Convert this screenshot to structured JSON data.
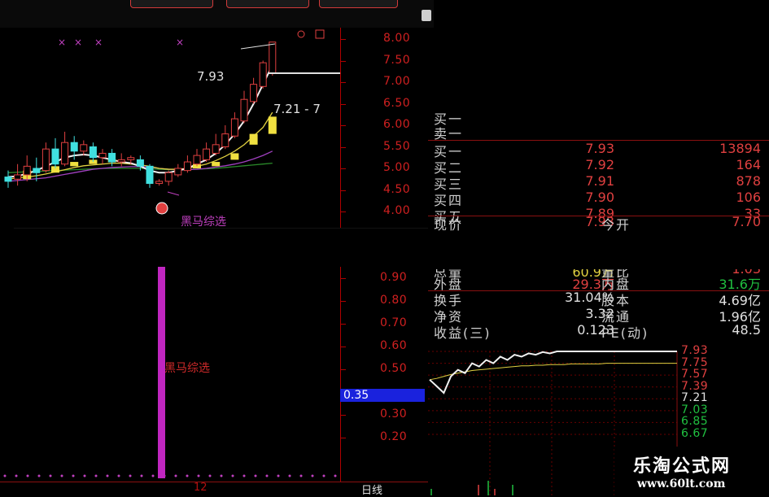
{
  "kline": {
    "price_ticks": [
      "8.00",
      "7.50",
      "7.00",
      "6.50",
      "6.00",
      "5.50",
      "5.00",
      "4.50",
      "4.00"
    ],
    "high_price": "7.93",
    "ref_price": "7.21 - 7",
    "signal_label": "黑马综选",
    "candles": [
      {
        "o": 4.8,
        "c": 4.7,
        "h": 4.95,
        "l": 4.55
      },
      {
        "o": 4.75,
        "c": 4.85,
        "h": 5.1,
        "l": 4.6
      },
      {
        "o": 4.85,
        "c": 5.05,
        "h": 5.3,
        "l": 4.7
      },
      {
        "o": 5.0,
        "c": 4.9,
        "h": 5.25,
        "l": 4.7
      },
      {
        "o": 4.95,
        "c": 5.45,
        "h": 5.6,
        "l": 4.9
      },
      {
        "o": 5.45,
        "c": 5.1,
        "h": 5.7,
        "l": 5.0
      },
      {
        "o": 5.1,
        "c": 5.6,
        "h": 5.85,
        "l": 5.05
      },
      {
        "o": 5.6,
        "c": 5.4,
        "h": 5.75,
        "l": 5.2
      },
      {
        "o": 5.4,
        "c": 5.55,
        "h": 5.65,
        "l": 5.3
      },
      {
        "o": 5.5,
        "c": 5.25,
        "h": 5.6,
        "l": 5.15
      },
      {
        "o": 5.25,
        "c": 5.35,
        "h": 5.45,
        "l": 5.1
      },
      {
        "o": 5.35,
        "c": 5.15,
        "h": 5.45,
        "l": 5.05
      },
      {
        "o": 5.15,
        "c": 5.2,
        "h": 5.35,
        "l": 5.05
      },
      {
        "o": 5.2,
        "c": 5.25,
        "h": 5.3,
        "l": 5.1
      },
      {
        "o": 5.2,
        "c": 5.05,
        "h": 5.3,
        "l": 4.95
      },
      {
        "o": 5.05,
        "c": 4.65,
        "h": 5.1,
        "l": 4.55
      },
      {
        "o": 4.65,
        "c": 4.7,
        "h": 4.75,
        "l": 4.6
      },
      {
        "o": 4.7,
        "c": 4.9,
        "h": 4.95,
        "l": 4.6
      },
      {
        "o": 4.85,
        "c": 5.0,
        "h": 5.1,
        "l": 4.8
      },
      {
        "o": 4.95,
        "c": 5.15,
        "h": 5.3,
        "l": 4.9
      },
      {
        "o": 5.1,
        "c": 5.3,
        "h": 5.45,
        "l": 5.05
      },
      {
        "o": 5.2,
        "c": 5.45,
        "h": 5.6,
        "l": 5.15
      },
      {
        "o": 5.35,
        "c": 5.55,
        "h": 5.8,
        "l": 5.3
      },
      {
        "o": 5.5,
        "c": 5.8,
        "h": 6.0,
        "l": 5.45
      },
      {
        "o": 5.75,
        "c": 6.15,
        "h": 6.3,
        "l": 5.7
      },
      {
        "o": 6.1,
        "c": 6.6,
        "h": 6.8,
        "l": 6.05
      },
      {
        "o": 6.55,
        "c": 6.95,
        "h": 7.1,
        "l": 6.5
      },
      {
        "o": 6.9,
        "c": 7.45,
        "h": 7.5,
        "l": 6.85
      },
      {
        "o": 7.2,
        "c": 7.93,
        "h": 7.93,
        "l": 7.15
      }
    ],
    "ma_white": [
      4.8,
      4.82,
      4.88,
      4.95,
      5.05,
      5.15,
      5.25,
      5.3,
      5.32,
      5.3,
      5.25,
      5.2,
      5.15,
      5.12,
      5.05,
      4.95,
      4.9,
      4.9,
      4.95,
      5.0,
      5.1,
      5.2,
      5.35,
      5.55,
      5.8,
      6.1,
      6.5,
      6.95,
      7.4
    ],
    "ma_yellow": [
      4.75,
      4.78,
      4.8,
      4.83,
      4.87,
      4.92,
      4.97,
      5.02,
      5.06,
      5.08,
      5.1,
      5.12,
      5.12,
      5.1,
      5.08,
      5.05,
      5.0,
      4.98,
      4.98,
      5.0,
      5.05,
      5.1,
      5.18,
      5.28,
      5.4,
      5.55,
      5.75,
      5.95,
      6.3
    ],
    "ma_purple": [
      4.7,
      4.72,
      4.74,
      4.76,
      4.78,
      4.82,
      4.86,
      4.9,
      4.94,
      4.98,
      5.0,
      5.02,
      5.03,
      5.04,
      5.04,
      5.03,
      5.0,
      4.98,
      4.97,
      4.97,
      4.98,
      5.0,
      5.03,
      5.06,
      5.1,
      5.15,
      5.22,
      5.3,
      5.4
    ],
    "ma_green": [
      4.9,
      4.91,
      4.92,
      4.93,
      4.94,
      4.95,
      4.96,
      4.97,
      4.98,
      4.99,
      5.0,
      5.0,
      5.0,
      5.0,
      5.0,
      4.99,
      4.98,
      4.97,
      4.97,
      4.97,
      4.98,
      4.99,
      5.0,
      5.02,
      5.04,
      5.06,
      5.08,
      5.1,
      5.12
    ],
    "yellow_blocks": [
      {
        "i": 2,
        "lo": 4.75,
        "hi": 4.95
      },
      {
        "i": 5,
        "lo": 4.9,
        "hi": 5.05
      },
      {
        "i": 7,
        "lo": 5.05,
        "hi": 5.15
      },
      {
        "i": 9,
        "lo": 5.1,
        "hi": 5.2
      },
      {
        "i": 11,
        "lo": 5.15,
        "hi": 5.2
      },
      {
        "i": 20,
        "lo": 5.0,
        "hi": 5.1
      },
      {
        "i": 22,
        "lo": 5.05,
        "hi": 5.15
      },
      {
        "i": 24,
        "lo": 5.2,
        "hi": 5.35
      },
      {
        "i": 26,
        "lo": 5.55,
        "hi": 5.8
      },
      {
        "i": 28,
        "lo": 5.8,
        "hi": 6.2
      }
    ]
  },
  "indicator": {
    "ticks": [
      "0.90",
      "0.80",
      "0.70",
      "0.60",
      "0.50",
      "0.30",
      "0.20"
    ],
    "current_value": "0.35",
    "label": "黑马综选"
  },
  "bottom": {
    "date_label": "12",
    "cycle_label": "日线"
  },
  "quote": {
    "header_rows": [
      {
        "label": "买一"
      },
      {
        "label": "卖一"
      }
    ],
    "bid_rows": [
      {
        "label": "买一",
        "price": "7.93",
        "volume": "13894"
      },
      {
        "label": "买二",
        "price": "7.92",
        "volume": "164"
      },
      {
        "label": "买三",
        "price": "7.91",
        "volume": "878"
      },
      {
        "label": "买四",
        "price": "7.90",
        "volume": "106"
      },
      {
        "label": "买五",
        "price": "7.89",
        "volume": "33"
      }
    ],
    "current": {
      "label": "现价",
      "value": "7.93",
      "label2": "今开",
      "value2": "7.70"
    },
    "partial": {
      "label": "总量",
      "value": "60.9万",
      "label2": "量比",
      "value2": "1.03"
    },
    "outer": {
      "label": "外盘",
      "value": "29.3万",
      "label2": "内盘",
      "value2": "31.6万"
    },
    "stats": [
      {
        "label": "换手",
        "value": "31.04%",
        "label2": "股本",
        "value2": "4.69亿"
      },
      {
        "label": "净资",
        "value": "3.32",
        "label2": "流通",
        "value2": "1.96亿"
      },
      {
        "label": "收益(三)",
        "value": "0.123",
        "label2": "PE(动)",
        "value2": "48.5"
      }
    ],
    "colors": {
      "red": "#e04040",
      "green": "#20c040",
      "white": "#e0e0e0"
    }
  },
  "intraday": {
    "ticks": [
      {
        "v": "7.93",
        "color": "#e04040"
      },
      {
        "v": "7.75",
        "color": "#e04040"
      },
      {
        "v": "7.57",
        "color": "#e04040"
      },
      {
        "v": "7.39",
        "color": "#e04040"
      },
      {
        "v": "7.21",
        "color": "#e0e0e0"
      },
      {
        "v": "7.03",
        "color": "#20c040"
      },
      {
        "v": "6.85",
        "color": "#20c040"
      },
      {
        "v": "6.67",
        "color": "#20c040"
      }
    ],
    "price_line": [
      7.5,
      7.4,
      7.3,
      7.55,
      7.65,
      7.6,
      7.75,
      7.7,
      7.8,
      7.75,
      7.85,
      7.8,
      7.88,
      7.85,
      7.9,
      7.88,
      7.92,
      7.9,
      7.93,
      7.93,
      7.93,
      7.93,
      7.93,
      7.93,
      7.93,
      7.93,
      7.93,
      7.93,
      7.93,
      7.93,
      7.93,
      7.93,
      7.93,
      7.93,
      7.93,
      7.93
    ],
    "avg_line": [
      7.5,
      7.52,
      7.55,
      7.58,
      7.6,
      7.62,
      7.64,
      7.65,
      7.66,
      7.67,
      7.68,
      7.69,
      7.7,
      7.71,
      7.71,
      7.72,
      7.72,
      7.73,
      7.73,
      7.73,
      7.74,
      7.74,
      7.74,
      7.74,
      7.74,
      7.75,
      7.75,
      7.75,
      7.75,
      7.75,
      7.75,
      7.75,
      7.75,
      7.75,
      7.75,
      7.75
    ]
  },
  "watermark": {
    "title": "乐淘公式网",
    "url": "www.60lt.com"
  }
}
